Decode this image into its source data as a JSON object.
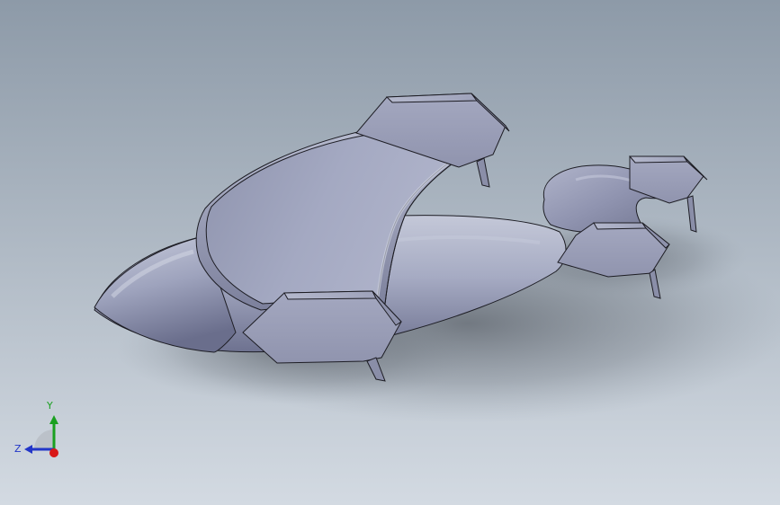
{
  "viewport": {
    "background_top": "#8d9aa8",
    "background_bottom": "#d3dae2",
    "model_color": "#9fa3bd",
    "edge_color": "#1d1d24",
    "shadow_color": "#5a6068"
  },
  "triad": {
    "y_label": "Y",
    "z_label": "Z",
    "y_color": "#1aa020",
    "z_color": "#2236c8",
    "x_color": "#d81818"
  }
}
